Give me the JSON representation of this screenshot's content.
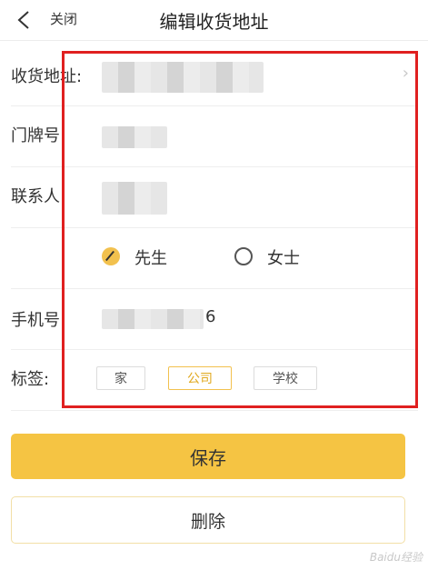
{
  "header": {
    "back_icon": "chevron-left-icon",
    "close_label": "关闭",
    "title": "编辑收货地址"
  },
  "form": {
    "address": {
      "label": "收货地址:"
    },
    "door_number": {
      "label": "门牌号:"
    },
    "contact": {
      "label": "联系人:"
    },
    "gender": {
      "options": [
        {
          "label": "先生",
          "selected": true
        },
        {
          "label": "女士",
          "selected": false
        }
      ]
    },
    "phone": {
      "label": "手机号",
      "visible_suffix": "6"
    },
    "tags": {
      "label": "标签:",
      "options": [
        {
          "label": "家",
          "active": false
        },
        {
          "label": "公司",
          "active": true
        },
        {
          "label": "学校",
          "active": false
        }
      ]
    }
  },
  "actions": {
    "save_label": "保存",
    "delete_label": "删除"
  },
  "watermark": "Baidu经验",
  "colors": {
    "accent": "#f5c443",
    "highlight_border": "#e02020",
    "active_tag": "#e0a81d"
  }
}
